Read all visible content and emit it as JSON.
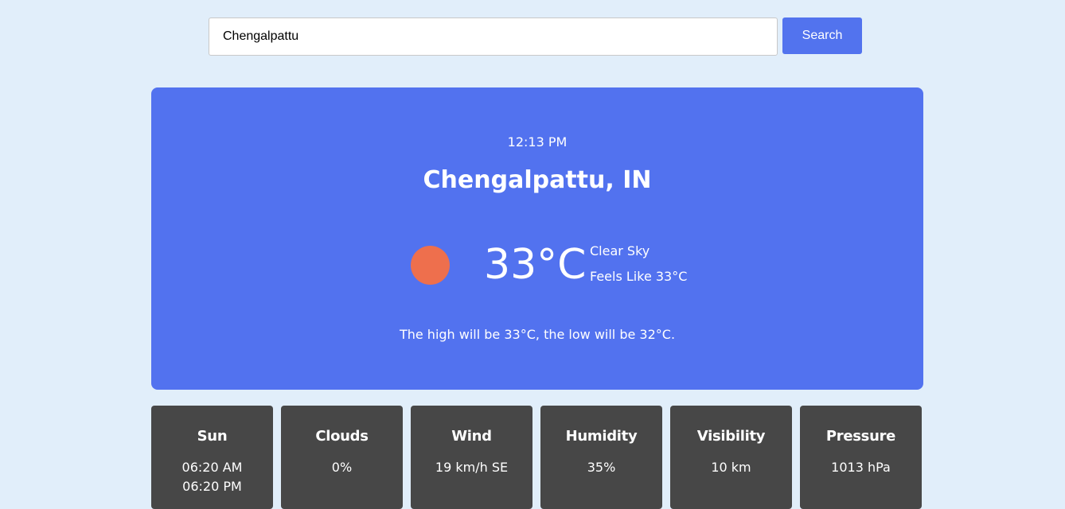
{
  "search": {
    "value": "Chengalpattu",
    "button_label": "Search"
  },
  "weather": {
    "time": "12:13 PM",
    "location": "Chengalpattu, IN",
    "icon": "sun-icon",
    "temperature": "33°C",
    "condition": "Clear Sky",
    "feels_like": "Feels Like 33°C",
    "summary": "The high will be 33°C, the low will be 32°C."
  },
  "tiles": [
    {
      "title": "Sun",
      "value": "06:20 AM",
      "value2": "06:20 PM"
    },
    {
      "title": "Clouds",
      "value": "0%"
    },
    {
      "title": "Wind",
      "value": "19 km/h SE"
    },
    {
      "title": "Humidity",
      "value": "35%"
    },
    {
      "title": "Visibility",
      "value": "10 km"
    },
    {
      "title": "Pressure",
      "value": "1013 hPa"
    }
  ],
  "colors": {
    "page_background": "#e1eefa",
    "card_background": "#5272ef",
    "sun": "#ee6f4d",
    "tile_background": "#474747"
  }
}
